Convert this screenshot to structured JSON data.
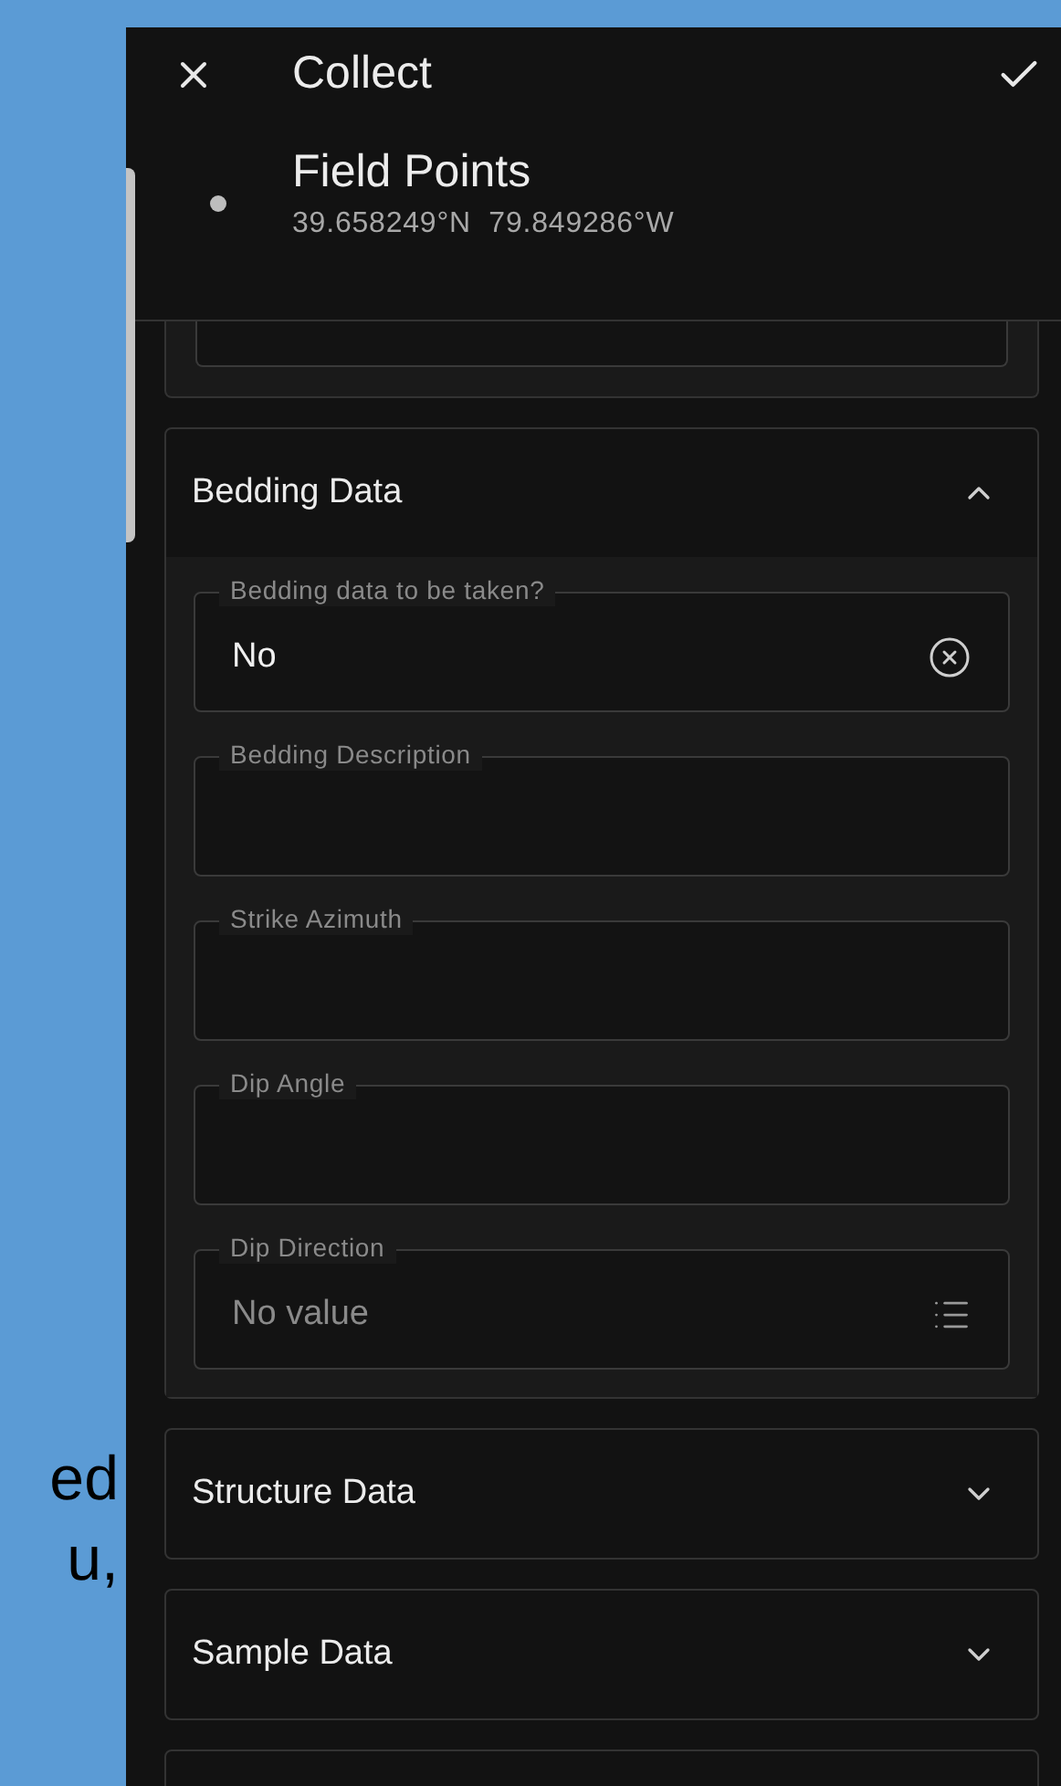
{
  "background_text": [
    "ed",
    "u,"
  ],
  "header": {
    "title": "Collect",
    "layer": "Field Points",
    "coordinates": "39.658249°N  79.849286°W"
  },
  "sections": [
    {
      "title": "Bedding Data",
      "expanded": true,
      "fields": [
        {
          "kind": "choice",
          "label": "Bedding data to be taken?",
          "value": "No"
        },
        {
          "kind": "text",
          "label": "Bedding Description"
        },
        {
          "kind": "text",
          "label": "Strike Azimuth"
        },
        {
          "kind": "text",
          "label": "Dip Angle"
        },
        {
          "kind": "list",
          "label": "Dip Direction",
          "placeholder": "No value"
        }
      ]
    },
    {
      "title": "Structure Data",
      "expanded": false
    },
    {
      "title": "Sample Data",
      "expanded": false
    }
  ]
}
